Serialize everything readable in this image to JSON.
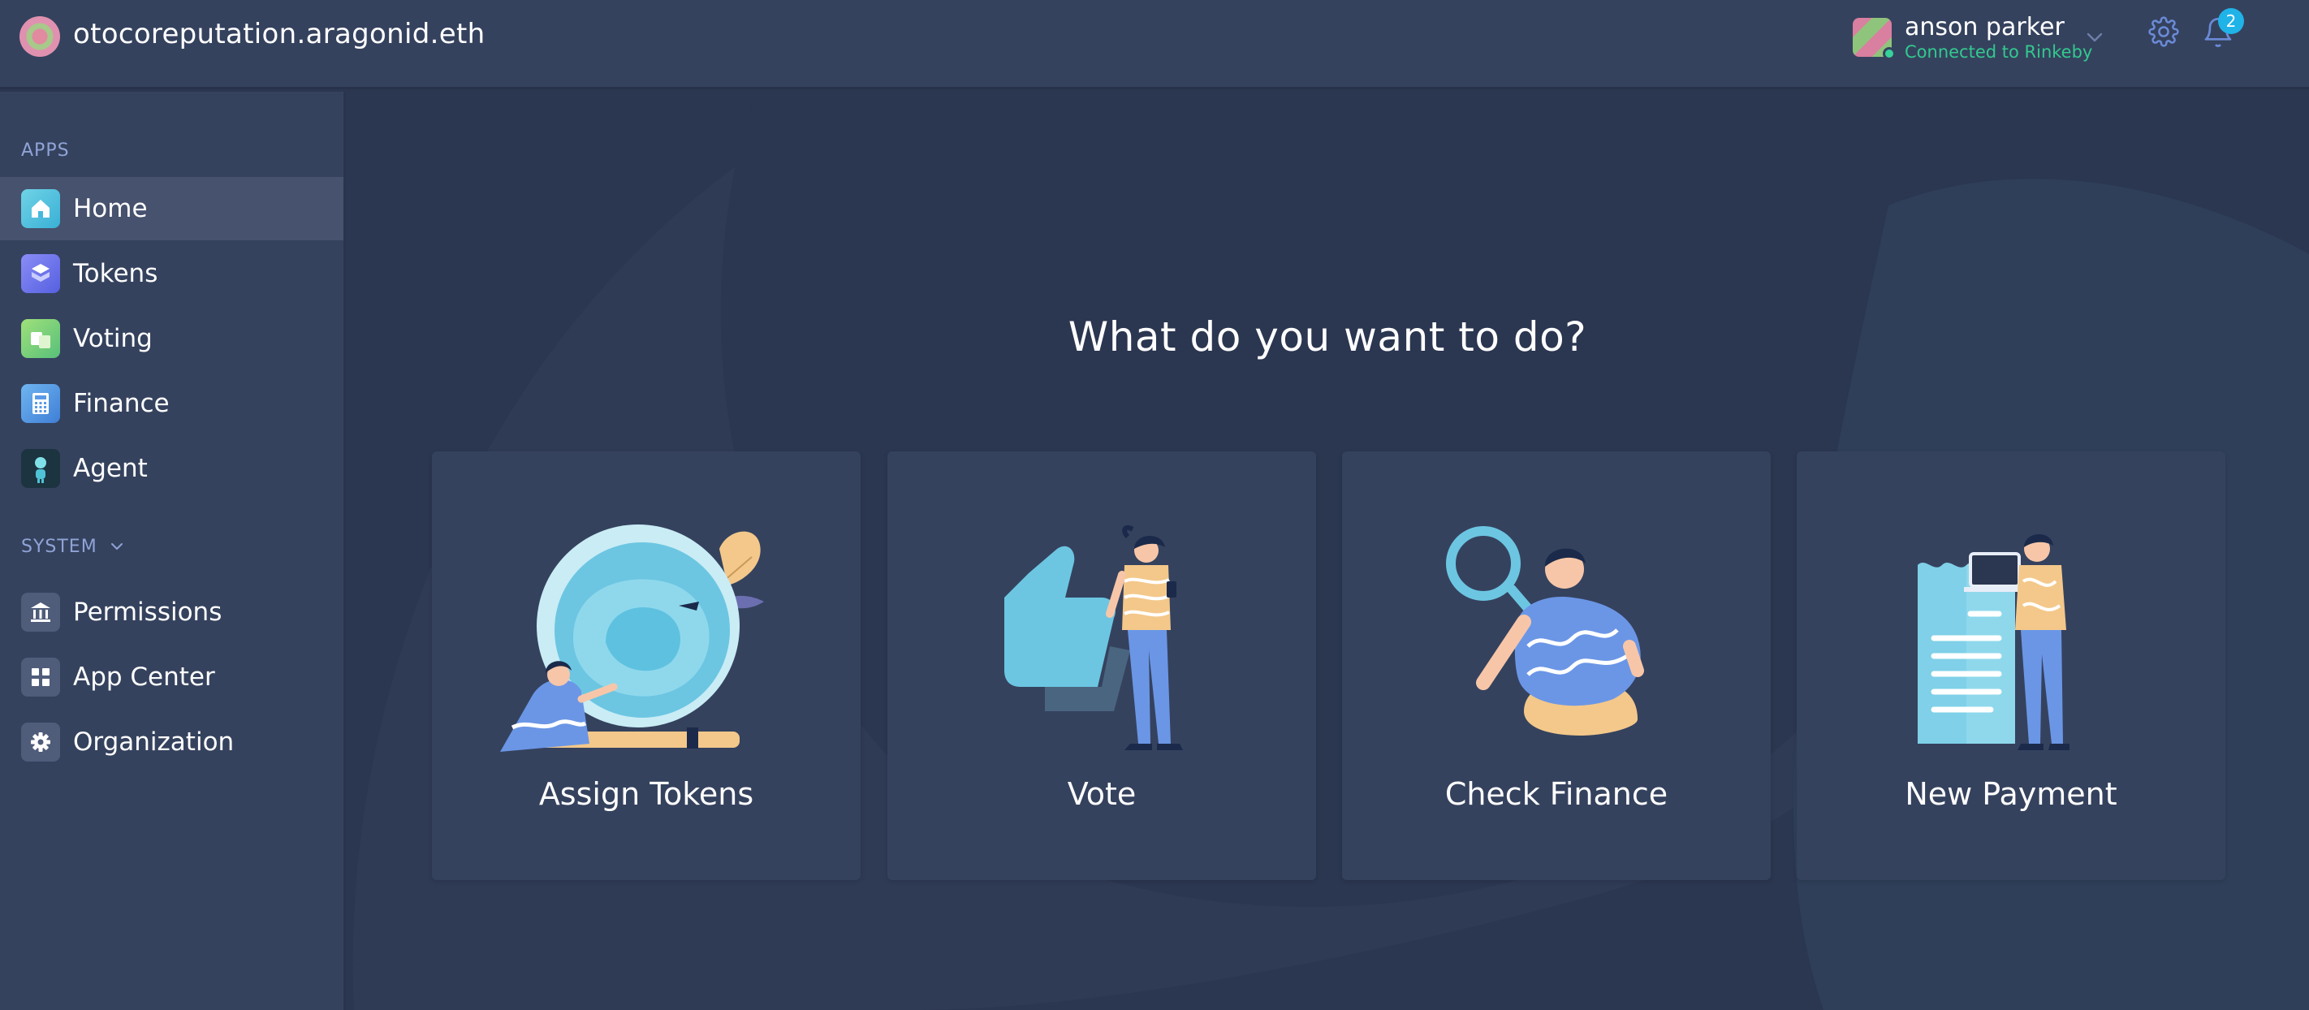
{
  "header": {
    "org_name": "otocoreputation.aragonid.eth",
    "user": {
      "name": "anson parker",
      "network_status": "Connected to Rinkeby"
    },
    "notifications_count": "2"
  },
  "sidebar": {
    "apps_section_label": "APPS",
    "apps": [
      {
        "label": "Home",
        "icon": "home-icon",
        "active": true
      },
      {
        "label": "Tokens",
        "icon": "tokens-icon",
        "active": false
      },
      {
        "label": "Voting",
        "icon": "voting-icon",
        "active": false
      },
      {
        "label": "Finance",
        "icon": "finance-icon",
        "active": false
      },
      {
        "label": "Agent",
        "icon": "agent-icon",
        "active": false
      }
    ],
    "system_section_label": "SYSTEM",
    "system": [
      {
        "label": "Permissions",
        "icon": "permissions-icon"
      },
      {
        "label": "App Center",
        "icon": "app-center-icon"
      },
      {
        "label": "Organization",
        "icon": "organization-icon"
      }
    ]
  },
  "main": {
    "heading": "What do you want to do?",
    "actions": [
      {
        "label": "Assign Tokens",
        "icon": "assign-tokens-illustration"
      },
      {
        "label": "Vote",
        "icon": "vote-illustration"
      },
      {
        "label": "Check Finance",
        "icon": "check-finance-illustration"
      },
      {
        "label": "New Payment",
        "icon": "new-payment-illustration"
      }
    ]
  },
  "colors": {
    "background": "#2b3650",
    "panel": "#35425e",
    "active_item": "#46526e",
    "accent_green": "#32c98e",
    "badge_blue": "#1fb3e8",
    "section_label": "#8fa3d6"
  }
}
